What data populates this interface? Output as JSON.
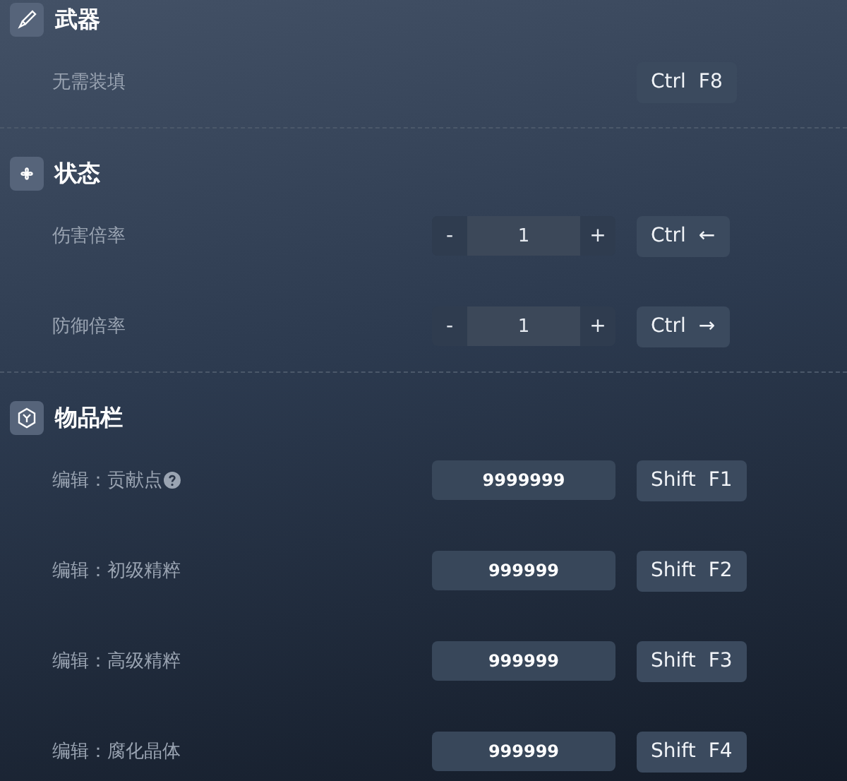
{
  "sections": [
    {
      "title": "武器",
      "rows": [
        {
          "kind": "text",
          "label": "无需装填",
          "hotkey": [
            "Ctrl",
            "F8"
          ]
        }
      ]
    },
    {
      "title": "状态",
      "rows": [
        {
          "kind": "stepper",
          "label": "伤害倍率",
          "minus": "-",
          "value": "1",
          "plus": "+",
          "hotkey": [
            "Ctrl",
            "←"
          ]
        },
        {
          "kind": "stepper",
          "label": "防御倍率",
          "minus": "-",
          "value": "1",
          "plus": "+",
          "hotkey": [
            "Ctrl",
            "→"
          ]
        }
      ]
    },
    {
      "title": "物品栏",
      "rows": [
        {
          "kind": "field",
          "label": "编辑：贡献点",
          "help": true,
          "value": "9999999",
          "hotkey": [
            "Shift",
            "F1"
          ]
        },
        {
          "kind": "field",
          "label": "编辑：初级精粹",
          "help": false,
          "value": "999999",
          "hotkey": [
            "Shift",
            "F2"
          ]
        },
        {
          "kind": "field",
          "label": "编辑：高级精粹",
          "help": false,
          "value": "999999",
          "hotkey": [
            "Shift",
            "F3"
          ]
        },
        {
          "kind": "field",
          "label": "编辑：腐化晶体",
          "help": false,
          "value": "999999",
          "hotkey": [
            "Shift",
            "F4"
          ]
        }
      ]
    }
  ]
}
